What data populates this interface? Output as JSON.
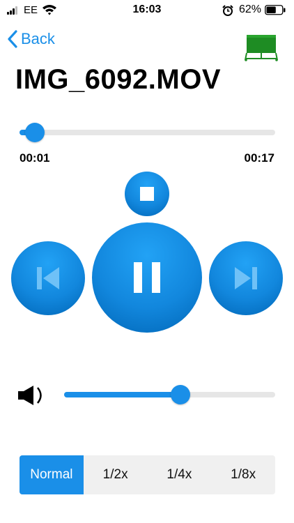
{
  "status_bar": {
    "carrier": "EE",
    "time": "16:03",
    "battery_percent": "62%",
    "battery_level": 0.62,
    "icons": [
      "signal-icon",
      "wifi-icon",
      "alarm-icon",
      "battery-icon"
    ]
  },
  "nav": {
    "back_label": "Back",
    "right_icon": "airplay-screen-icon"
  },
  "title": "IMG_6092.MOV",
  "player": {
    "elapsed": "00:01",
    "duration": "00:17",
    "progress": 0.06,
    "volume": 0.55,
    "controls": [
      "stop-icon",
      "previous-icon",
      "pause-icon",
      "next-icon"
    ]
  },
  "speed": {
    "options": [
      "Normal",
      "1/2x",
      "1/4x",
      "1/8x"
    ],
    "selected_index": 0
  },
  "colors": {
    "accent": "#1a8fe8",
    "track": "#e6e6e6",
    "segment_bg": "#f0f0f0",
    "airplay_green": "#1e8c23"
  }
}
